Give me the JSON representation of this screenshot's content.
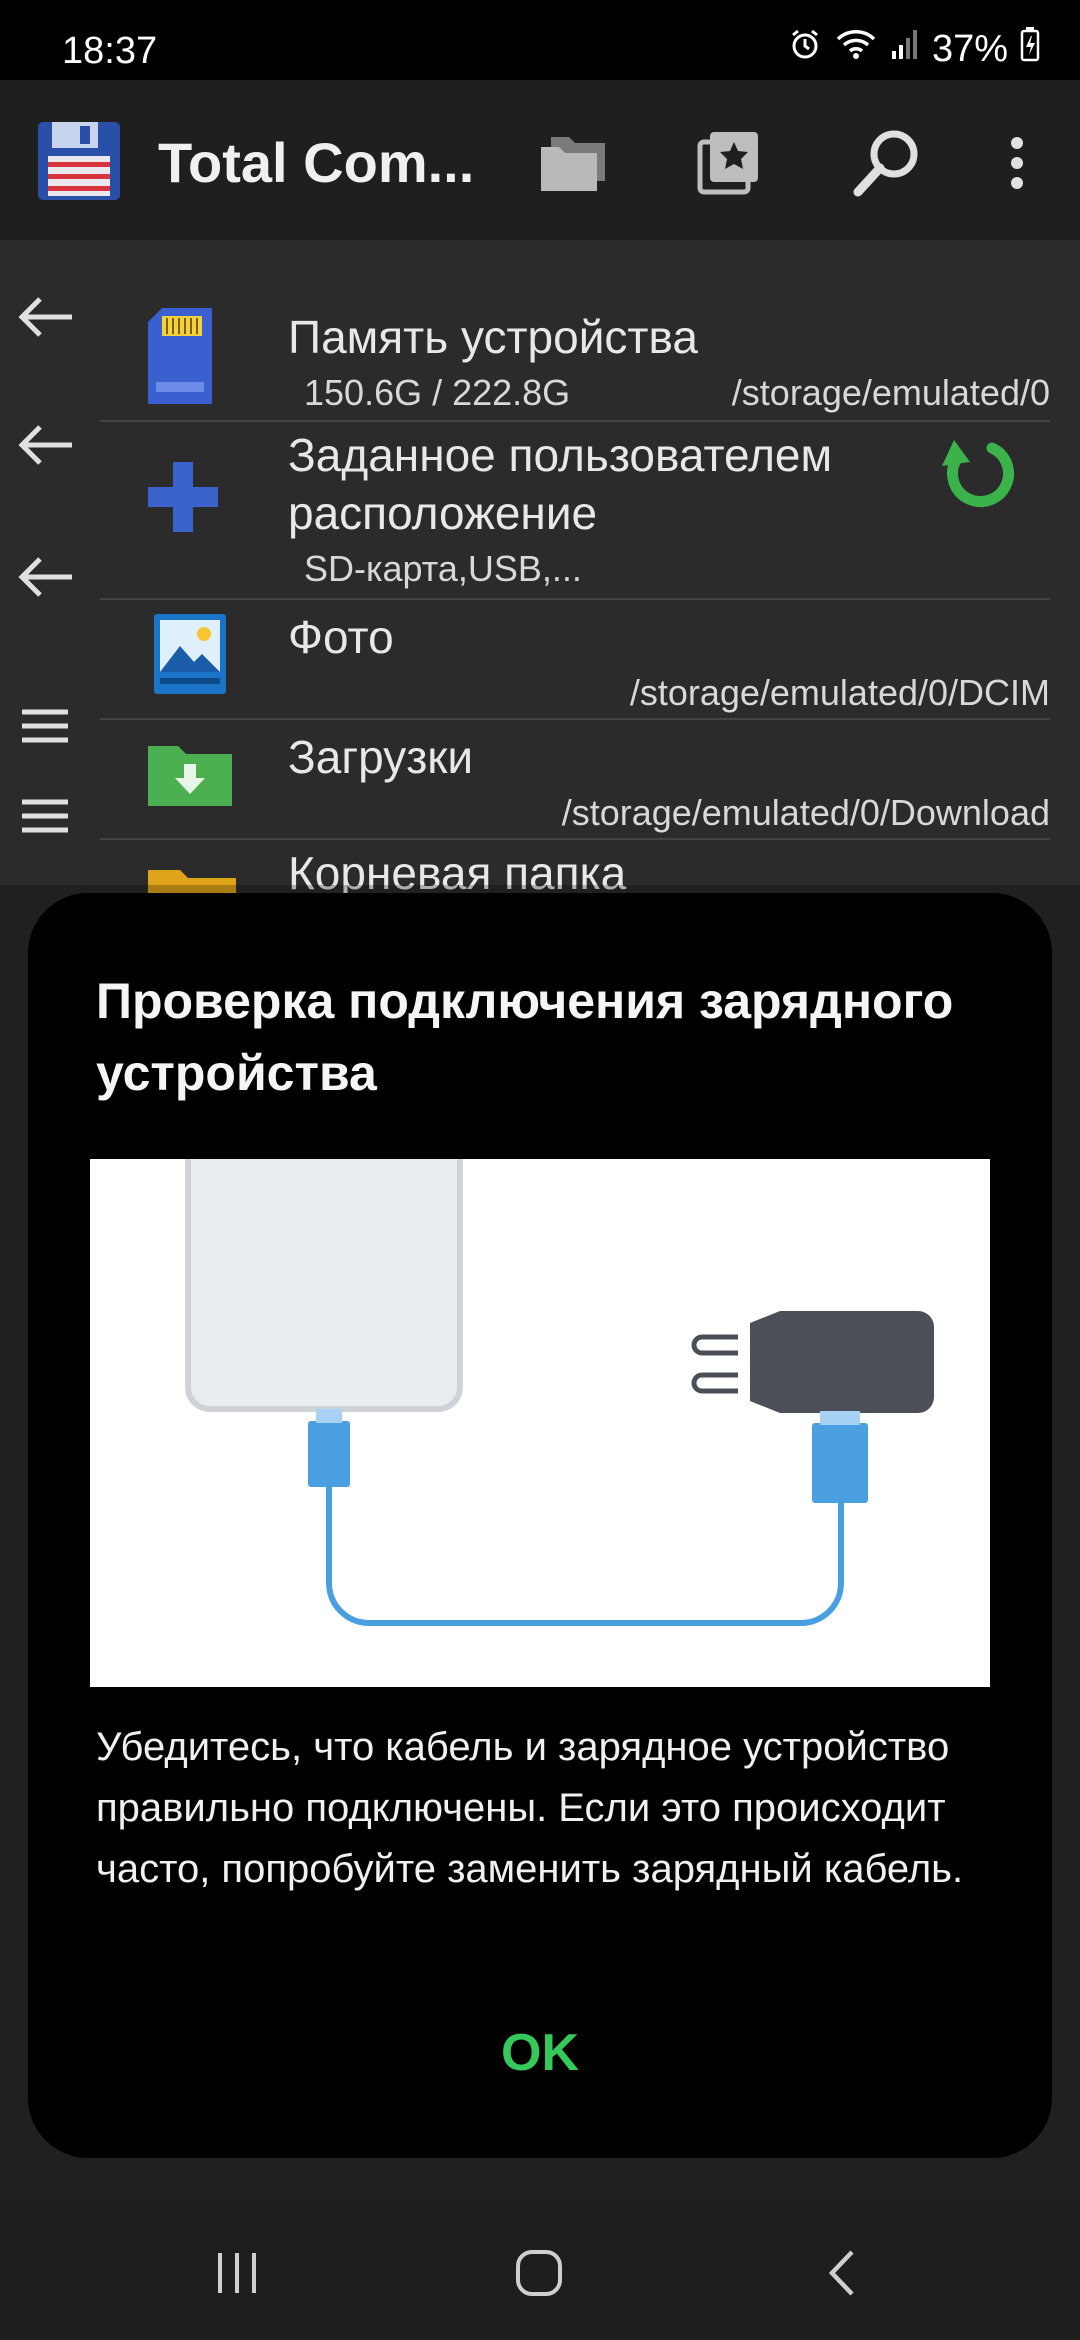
{
  "status_bar": {
    "time": "18:37",
    "battery": "37%"
  },
  "toolbar": {
    "title": "Total Com..."
  },
  "locations": [
    {
      "title": "Память устройства",
      "size": "150.6G / 222.8G",
      "path": "/storage/emulated/0"
    },
    {
      "title_line1": "Заданное пользователем",
      "title_line2": "расположение",
      "subtitle": "SD-карта,USB,..."
    },
    {
      "title": "Фото",
      "path": "/storage/emulated/0/DCIM"
    },
    {
      "title": "Загрузки",
      "path": "/storage/emulated/0/Download"
    },
    {
      "title": "Корневая папка"
    }
  ],
  "dialog": {
    "title": "Проверка подключения зарядного устройства",
    "body": "Убедитесь, что кабель и зарядное устройство правильно подключены. Если это происходит часто, попробуйте заменить зарядный кабель.",
    "ok_label": "OK"
  },
  "colors": {
    "ok_green": "#35c85a",
    "refresh_green": "#3bb34a",
    "cable_blue": "#4a9fe0",
    "folder_green": "#4caf50",
    "folder_yellow": "#e0a41a"
  }
}
